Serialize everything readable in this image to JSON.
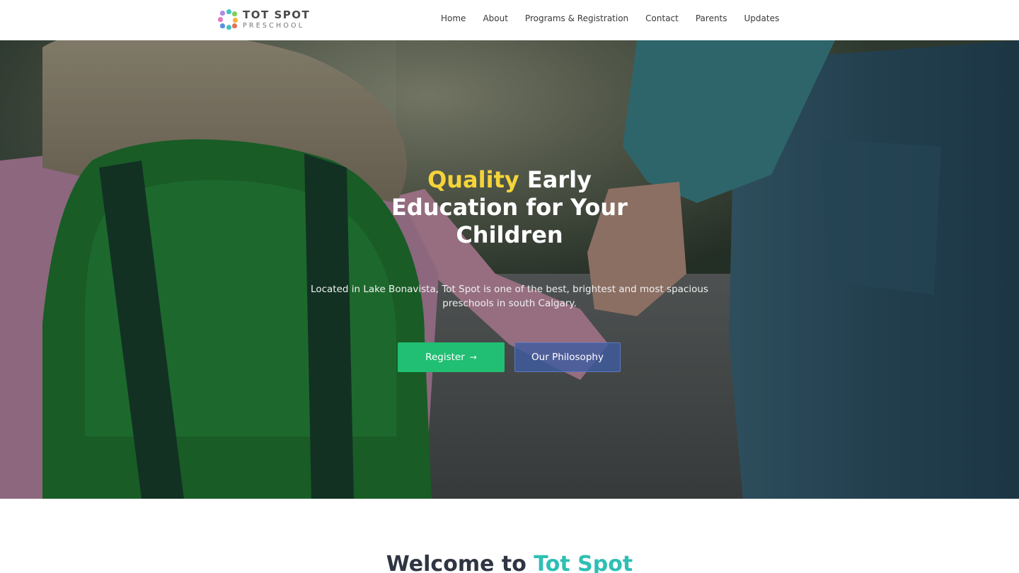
{
  "brand": {
    "name": "TOT SPOT",
    "tagline": "PRESCHOOL",
    "logo_colors": [
      "#b08be3",
      "#3fc7c1",
      "#f4b43c",
      "#e6705e",
      "#7fcf5e",
      "#5c8fe0",
      "#e47bc2"
    ]
  },
  "nav": {
    "items": [
      "Home",
      "About",
      "Programs & Registration",
      "Contact",
      "Parents",
      "Updates"
    ]
  },
  "hero": {
    "title_highlight": "Quality",
    "title_rest": " Early Education for Your Children",
    "description": "Located in Lake Bonavista, Tot Spot is one of the best, brightest and most spacious preschools in south Calgary.",
    "register_label": "Register",
    "register_arrow": "→",
    "philosophy_label": "Our Philosophy",
    "colors": {
      "highlight": "#f5d43a",
      "register_bg": "#21bf73",
      "philosophy_bg": "#405ca0"
    }
  },
  "welcome": {
    "prefix": "Welcome to ",
    "accent": "Tot Spot",
    "accent_color": "#2fbfb4"
  }
}
